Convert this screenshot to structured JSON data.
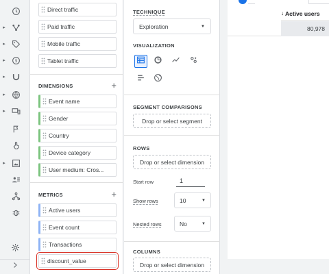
{
  "variables": {
    "segments": [
      {
        "label": "Direct traffic"
      },
      {
        "label": "Paid traffic"
      },
      {
        "label": "Mobile traffic"
      },
      {
        "label": "Tablet traffic"
      }
    ],
    "dimensions_title": "DIMENSIONS",
    "dimensions": [
      {
        "label": "Event name"
      },
      {
        "label": "Gender"
      },
      {
        "label": "Country"
      },
      {
        "label": "Device category"
      },
      {
        "label": "User medium: Cros..."
      }
    ],
    "metrics_title": "METRICS",
    "metrics": [
      {
        "label": "Active users"
      },
      {
        "label": "Event count"
      },
      {
        "label": "Transactions"
      },
      {
        "label": "discount_value"
      }
    ],
    "plus": "+"
  },
  "tab_settings": {
    "technique_label": "TECHNIQUE",
    "technique_value": "Exploration",
    "visualization_label": "VISUALIZATION",
    "segment_label": "SEGMENT COMPARISONS",
    "segment_drop": "Drop or select segment",
    "rows_label": "ROWS",
    "rows_drop": "Drop or select dimension",
    "start_row_label": "Start row",
    "start_row_value": "1",
    "show_rows_label": "Show rows",
    "show_rows_value": "10",
    "nested_rows_label": "Nested rows",
    "nested_rows_value": "No",
    "columns_label": "COLUMNS",
    "columns_drop": "Drop or select dimension"
  },
  "table": {
    "header": "Active users",
    "sort_arrow": "↓",
    "value": "80,978"
  },
  "colors": {
    "accent": "#1a73e8",
    "dimension": "#7cc47f",
    "metric": "#8fb4f5",
    "highlight": "#d93025"
  },
  "icons": {
    "rail": [
      "clock-icon",
      "branch-icon",
      "tag-icon",
      "dollar-icon",
      "magnet-icon",
      "globe-icon",
      "devices-icon",
      "flag-icon",
      "touch-icon",
      "image-icon",
      "people-icon",
      "flow-icon",
      "bug-icon",
      "gear-icon",
      "chevron-right-icon"
    ]
  }
}
